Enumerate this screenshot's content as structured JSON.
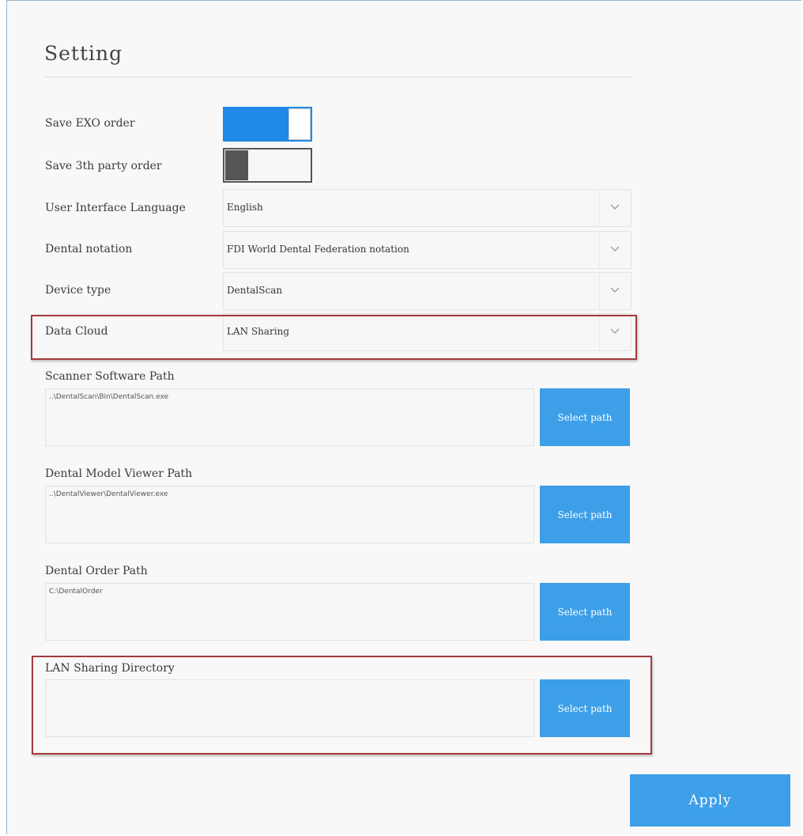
{
  "page": {
    "title": "Setting"
  },
  "toggles": [
    {
      "label": "Save EXO order",
      "state": "on"
    },
    {
      "label": "Save 3th party order",
      "state": "off"
    }
  ],
  "selects": [
    {
      "label": "User Interface Language",
      "value": "English"
    },
    {
      "label": "Dental notation",
      "value": "FDI World Dental Federation notation"
    },
    {
      "label": "Device type",
      "value": "DentalScan"
    },
    {
      "label": "Data Cloud",
      "value": "LAN Sharing"
    }
  ],
  "paths": [
    {
      "label": "Scanner Software Path",
      "value": "..\\DentalScan\\Bin\\DentalScan.exe",
      "button": "Select path"
    },
    {
      "label": "Dental Model Viewer Path",
      "value": "..\\DentalViewer\\DentalViewer.exe",
      "button": "Select path"
    },
    {
      "label": "Dental Order Path",
      "value": "C:\\DentalOrder",
      "button": "Select path"
    },
    {
      "label": "LAN Sharing Directory",
      "value": "",
      "button": "Select path"
    }
  ],
  "apply_label": "Apply",
  "colors": {
    "accent": "#3d9fe8",
    "toggle_on": "#2189e6",
    "highlight": "#a43a3a",
    "toggle_off_knob": "#555555"
  },
  "icons": {
    "dropdown": "chevron-down-icon"
  }
}
